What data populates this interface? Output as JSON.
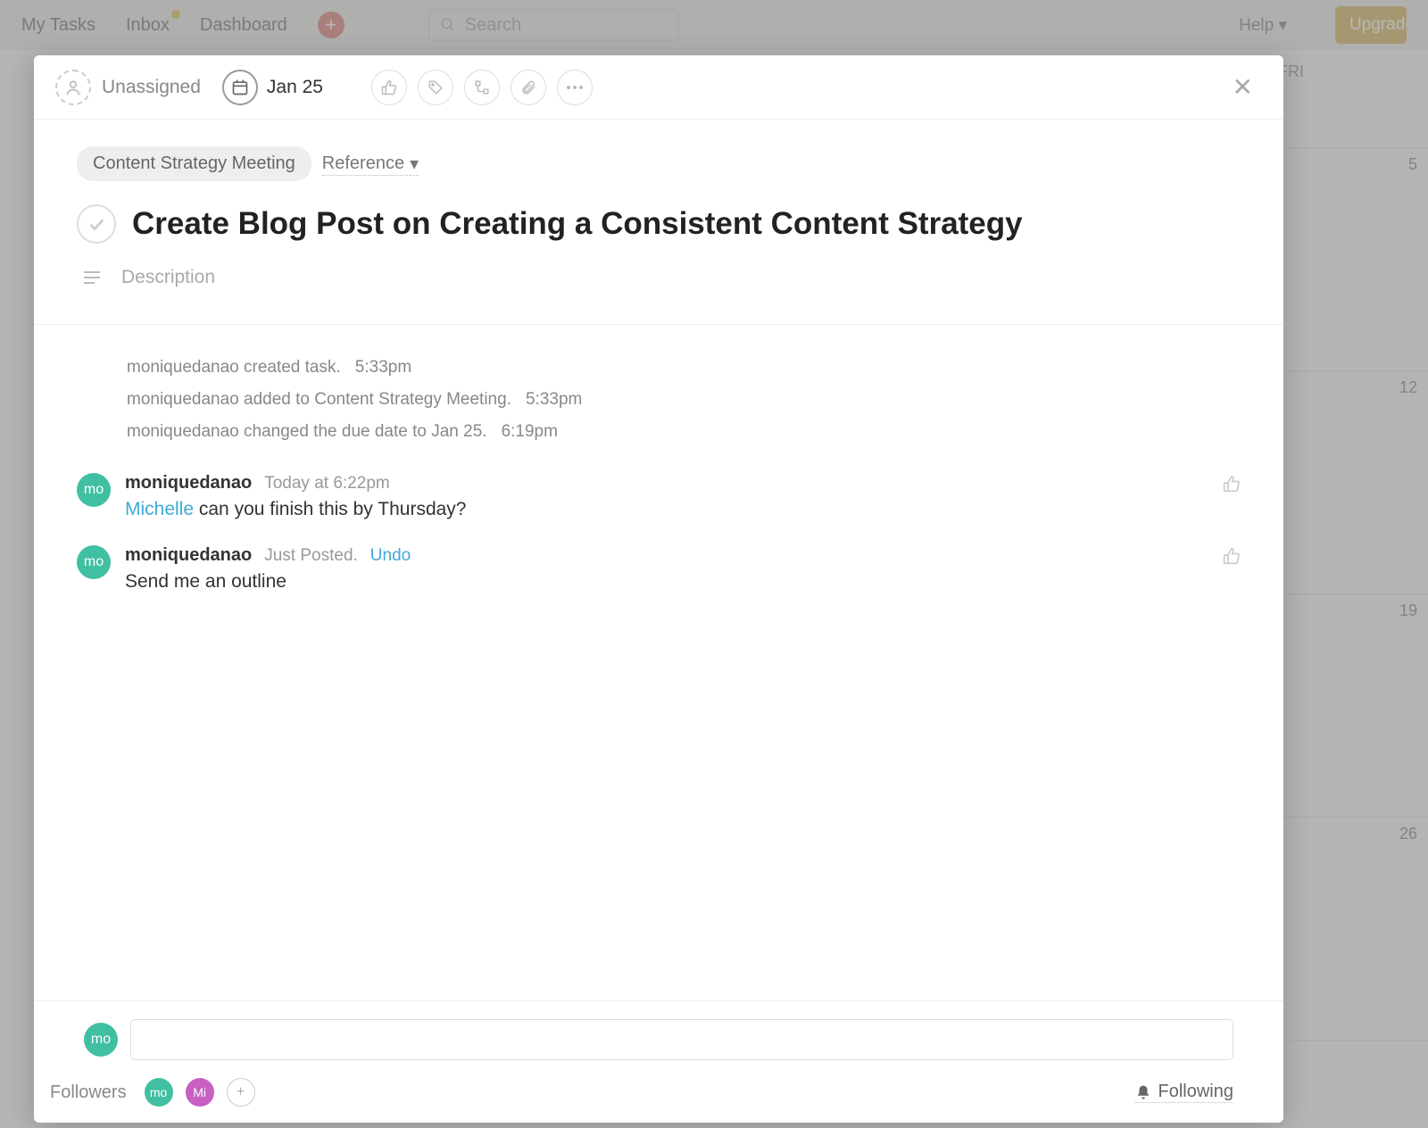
{
  "topbar": {
    "my_tasks": "My Tasks",
    "inbox": "Inbox",
    "dashboard": "Dashboard",
    "search_placeholder": "Search",
    "help": "Help",
    "upgrade": "Upgrade"
  },
  "calendar": {
    "day_label": "FRI",
    "dates": [
      "5",
      "12",
      "19",
      "26"
    ]
  },
  "task": {
    "assignee": "Unassigned",
    "due_date": "Jan 25",
    "project_chip": "Content Strategy Meeting",
    "reference_label": "Reference",
    "title": "Create Blog Post on Creating a Consistent Content Strategy",
    "description_placeholder": "Description"
  },
  "activity": [
    {
      "user": "moniquedanao",
      "text": "created task.",
      "time": "5:33pm"
    },
    {
      "user": "moniquedanao",
      "text": "added to Content Strategy Meeting.",
      "time": "5:33pm"
    },
    {
      "user": "moniquedanao",
      "text": "changed the due date to Jan 25.",
      "time": "6:19pm"
    }
  ],
  "comments": [
    {
      "avatar": "mo",
      "user": "moniquedanao",
      "timestamp": "Today at 6:22pm",
      "undo": "",
      "mention": "Michelle",
      "text": "can you finish this by Thursday?"
    },
    {
      "avatar": "mo",
      "user": "moniquedanao",
      "timestamp": "Just Posted.",
      "undo": "Undo",
      "mention": "",
      "text": "Send me an outline"
    }
  ],
  "composer": {
    "avatar": "mo"
  },
  "followers": {
    "label": "Followers",
    "items": [
      {
        "initials": "mo",
        "color": "teal"
      },
      {
        "initials": "Mi",
        "color": "mag"
      }
    ],
    "following": "Following"
  }
}
